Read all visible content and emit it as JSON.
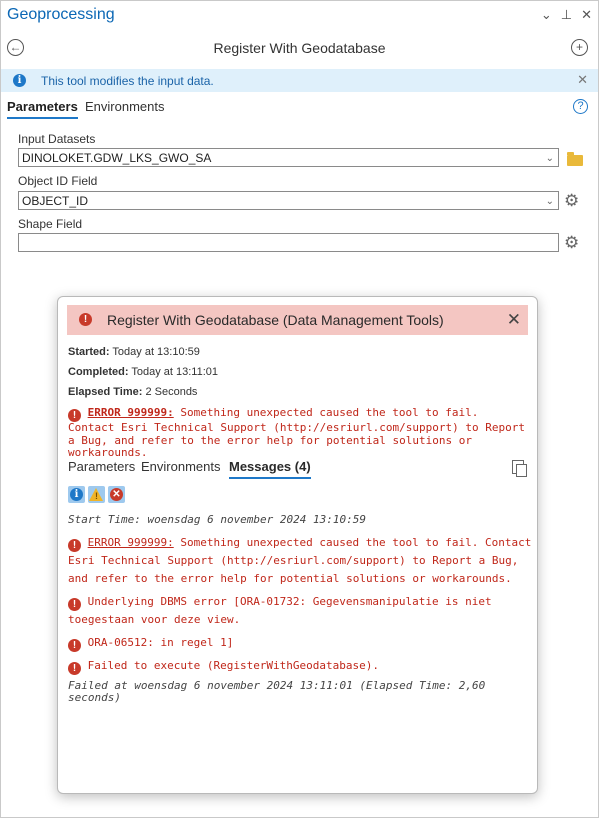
{
  "window": {
    "title": "Geoprocessing",
    "controls": [
      "⌄",
      "⊥",
      "✕"
    ]
  },
  "tool": {
    "title": "Register With Geodatabase"
  },
  "info_bar": {
    "text": "This tool modifies the input data."
  },
  "tabs": {
    "parameters": "Parameters",
    "environments": "Environments"
  },
  "params": {
    "input_datasets": {
      "label": "Input Datasets",
      "value": "DINOLOKET.GDW_LKS_GWO_SA"
    },
    "object_id_field": {
      "label": "Object ID Field",
      "value": "OBJECT_ID"
    },
    "shape_field": {
      "label": "Shape Field",
      "value": ""
    }
  },
  "dialog": {
    "title": "Register With Geodatabase (Data Management Tools)",
    "started_label": "Started:",
    "started_value": "Today at 13:10:59",
    "completed_label": "Completed:",
    "completed_value": "Today at 13:11:01",
    "elapsed_label": "Elapsed Time:",
    "elapsed_value": "2 Seconds",
    "summary_code": "ERROR 999999:",
    "summary_text": " Something unexpected caused the tool to fail. Contact Esri Technical Support (http://esriurl.com/support) to Report a Bug, and refer to the error help for potential solutions or workarounds.",
    "tabs": {
      "parameters": "Parameters",
      "environments": "Environments",
      "messages": "Messages (4)"
    },
    "messages": {
      "start": "Start Time: woensdag 6 november 2024 13:10:59",
      "error1_code": "ERROR 999999:",
      "error1_text": " Something unexpected caused the tool to fail. Contact Esri Technical Support (http://esriurl.com/support) to Report a Bug, and refer to the error help for potential solutions or workarounds.",
      "error2": "Underlying DBMS error [ORA-01732: Gegevensmanipulatie is niet toegestaan voor deze view.",
      "error3": "ORA-06512: in regel 1]",
      "error4": "Failed to execute (RegisterWithGeodatabase).",
      "failed": "Failed at woensdag 6 november 2024 13:11:01 (Elapsed Time: 2,60 seconds)"
    }
  }
}
